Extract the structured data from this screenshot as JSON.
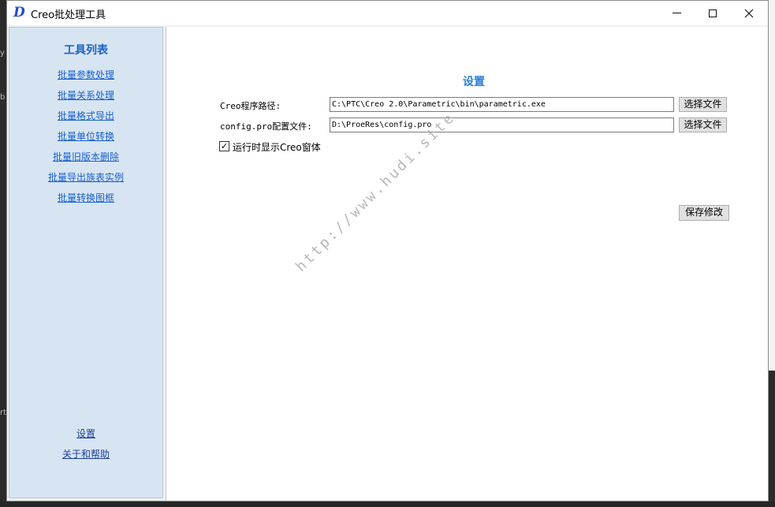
{
  "window": {
    "title": "Creo批处理工具",
    "app_icon_glyph": "D",
    "controls": [
      "minimize",
      "maximize",
      "close"
    ]
  },
  "sidebar": {
    "title": "工具列表",
    "items": [
      {
        "label": "批量参数处理"
      },
      {
        "label": "批量关系处理"
      },
      {
        "label": "批量格式导出"
      },
      {
        "label": "批量单位转换"
      },
      {
        "label": "批量旧版本删除"
      },
      {
        "label": "批量导出族表实例"
      },
      {
        "label": "批量转换图框"
      }
    ],
    "bottom_items": [
      {
        "label": "设置"
      },
      {
        "label": "关于和帮助"
      }
    ]
  },
  "settings": {
    "title": "设置",
    "creo_path_label": "Creo程序路径:",
    "creo_path_value": "C:\\PTC\\Creo 2.0\\Parametric\\bin\\parametric.exe",
    "config_label": "config.pro配置文件:",
    "config_value": "D:\\ProeRes\\config.pro",
    "browse_label": "选择文件",
    "show_window_label": "运行时显示Creo窗体",
    "show_window_checked": true,
    "save_label": "保存修改"
  },
  "watermark": "http://www.hudi.site",
  "colors": {
    "sidebar_bg": "#d7e5f2",
    "link": "#1a5fcf",
    "heading": "#2a7fd6",
    "icon": "#1f4fd1"
  }
}
